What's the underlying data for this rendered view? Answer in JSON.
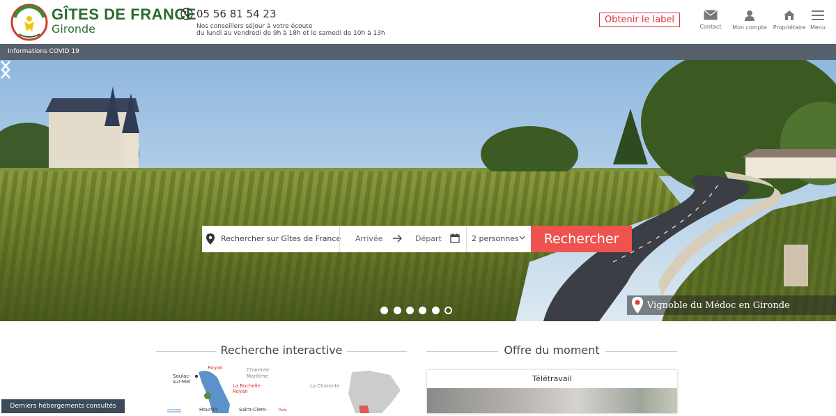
{
  "header": {
    "brand_title": "GÎTES DE FRANCE",
    "brand_sub": "Gironde",
    "phone": "05 56 81 54 23",
    "hours_line1": "Nos conseillers séjour à votre écoute",
    "hours_line2": "du lundi au vendredi de 9h à 18h et le samedi de 10h à 13h",
    "label_button": "Obtenir le label",
    "nav": [
      {
        "label": "Contact",
        "icon": "mail-icon"
      },
      {
        "label": "Mon compte",
        "icon": "user-icon"
      },
      {
        "label": "Propriétaire",
        "icon": "house-icon"
      },
      {
        "label": "Menu",
        "icon": "hamburger-icon"
      }
    ]
  },
  "covid": {
    "label": "Informations COVID 19"
  },
  "search": {
    "placeholder": "Rechercher sur Gîtes de France",
    "arrival": "Arrivée",
    "departure": "Départ",
    "guests": "2 personnes",
    "submit": "Rechercher"
  },
  "slider": {
    "slides": 6,
    "active_index": 5,
    "caption": "Vignoble du Médoc en Gironde"
  },
  "sections": {
    "interactive": "Recherche interactive",
    "offer": "Offre du moment"
  },
  "map_labels": {
    "soulac": "Soulac-",
    "soulac2": "sur-Mer",
    "royan": "Royan",
    "charente_maritime": "Charente",
    "charente_maritime2": "Maritime",
    "la_rochelle": "La Rochelle",
    "royan2": "Royan",
    "la_charente": "La Charente",
    "hourtin": "Hourtin",
    "saint_clers": "Saint-Clers-",
    "paris": "Paris"
  },
  "offer": {
    "title": "Télétravail"
  },
  "recent": {
    "label": "Derniers hébergements consultés"
  },
  "colors": {
    "brand_green": "#2a6b2f",
    "accent_red": "#ef5350",
    "covid_bar": "#56616d"
  }
}
